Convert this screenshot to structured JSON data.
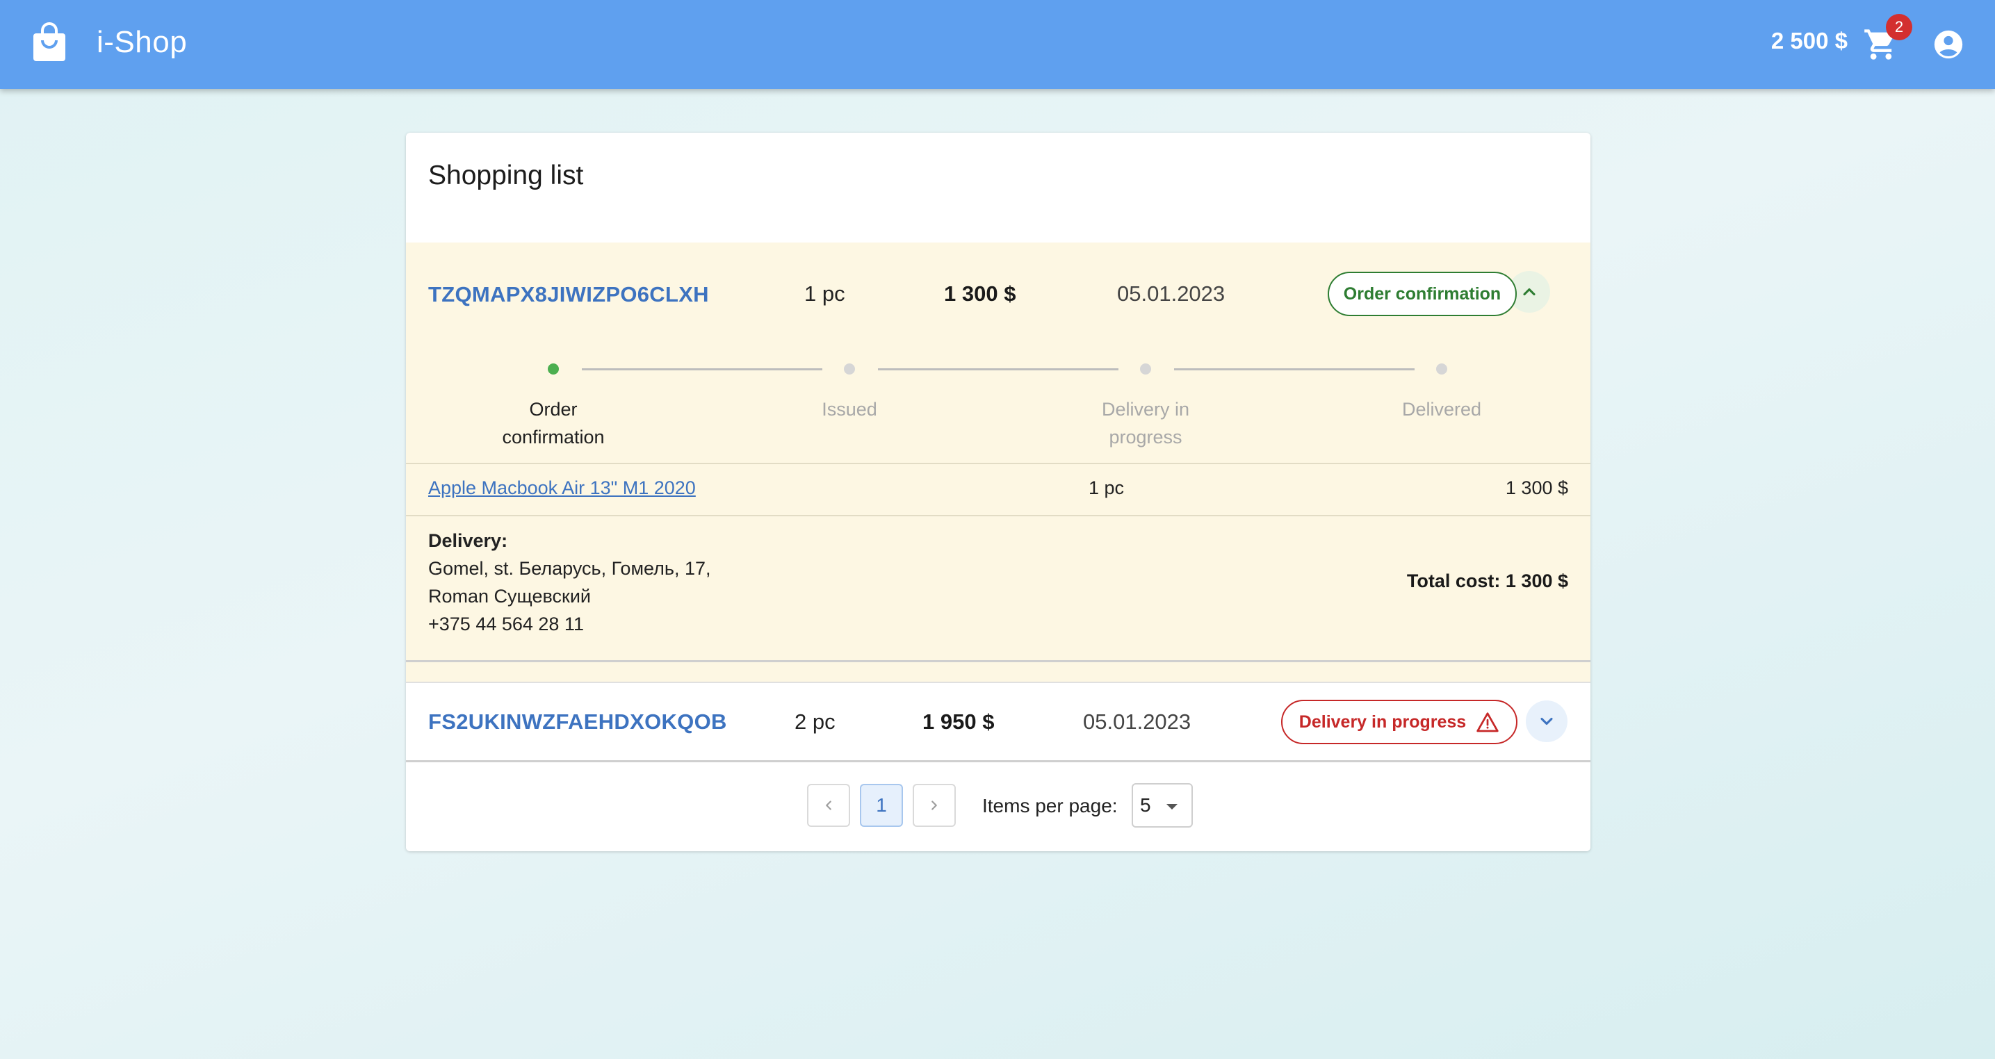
{
  "header": {
    "app_title": "i-Shop",
    "balance": "2 500 $",
    "cart_count": "2",
    "icons": [
      "shopping-bag-icon",
      "cart-icon",
      "account-circle-icon"
    ],
    "bar_color": "#5fa0ef"
  },
  "page": {
    "title": "Shopping list"
  },
  "orders": [
    {
      "id": "TZQMAPX8JIWIZPO6CLXH",
      "qty": "1 pc",
      "price": "1 300 $",
      "date": "05.01.2023",
      "status": "Order confirmation",
      "status_color": "#2e7d32",
      "expanded": true,
      "steps": [
        {
          "label": "Order confirmation",
          "active": true
        },
        {
          "label": "Issued",
          "active": false
        },
        {
          "label": "Delivery in progress",
          "active": false
        },
        {
          "label": "Delivered",
          "active": false
        }
      ],
      "items": [
        {
          "name": "Apple Macbook Air 13\" M1 2020",
          "qty": "1 pc",
          "price": "1 300 $"
        }
      ],
      "delivery": {
        "title": "Delivery:",
        "address": "Gomel, st. Беларусь, Гомель, 17,",
        "recipient": "Roman Сущевский",
        "phone": "+375 44 564 28 11"
      },
      "total": "Total cost: 1 300 $"
    },
    {
      "id": "FS2UKINWZFAEHDXOKQOB",
      "qty": "2 pc",
      "price": "1 950 $",
      "date": "05.01.2023",
      "status": "Delivery in progress",
      "status_color": "#c62828",
      "expanded": false
    }
  ],
  "pagination": {
    "current_page": "1",
    "items_per_page_label": "Items per page:",
    "items_per_page": "5"
  }
}
